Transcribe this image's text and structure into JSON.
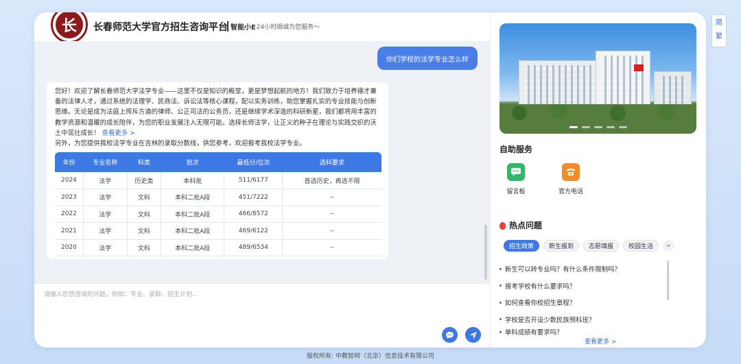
{
  "header": {
    "logo_text": "长",
    "title": "长春师范大学官方招生咨询平台",
    "brand": "智能小E",
    "slogan": "24小时竭诚为您服务～"
  },
  "chat": {
    "user_message": "你们学校的法学专业怎么样",
    "bot_reply": "您好！欢迎了解长春师范大学法学专业——这里不仅是知识的殿堂，更是梦想起航的地方！我们致力于培养德才兼备的法律人才，通过系统的法理学、民商法、诉讼法等核心课程，配以实务训练，助您掌握扎实的专业技能与创新思维。无论是成为法庭上挥斥方遒的律师、公正司法的公务员，还是继续学术深造的科研新星，我们都将用丰富的教学资源和温暖的成长陪伴，为您的职业发展注入无限可能。选择长师法学，让正义的种子在理论与实践交织的沃土中茁壮成长！",
    "read_more": "查看更多 >",
    "bot_reply_2": "另外，为您提供我校法学专业在吉林的录取分数线，供您参考，欢迎报考我校法学专业。",
    "table": {
      "headers": [
        "年份",
        "专业名称",
        "科类",
        "批次",
        "最低分/位次",
        "选科要求"
      ],
      "rows": [
        [
          "2024",
          "法学",
          "历史类",
          "本科批",
          "511/6177",
          "首选历史，再选不限"
        ],
        [
          "2023",
          "法学",
          "文科",
          "本科二批A段",
          "451/7222",
          "--"
        ],
        [
          "2022",
          "法学",
          "文科",
          "本科二批A段",
          "466/8572",
          "--"
        ],
        [
          "2021",
          "法学",
          "文科",
          "本科二批A段",
          "469/6122",
          "--"
        ],
        [
          "2020",
          "法学",
          "文科",
          "本科二批A段",
          "489/6534",
          "--"
        ]
      ]
    }
  },
  "input": {
    "placeholder": "请输入您想咨询的问题，例如：专业、录取、招生计划..."
  },
  "right": {
    "self_service_title": "自助服务",
    "services": [
      {
        "label": "留言板",
        "icon": "message-board-icon",
        "color": "#35b76a"
      },
      {
        "label": "官方电话",
        "icon": "phone-icon",
        "color": "#f08c2a"
      }
    ],
    "hot_title": "热点问题",
    "tags": [
      "招生政策",
      "新生报到",
      "志愿填报",
      "校园生活"
    ],
    "questions": [
      "新生可以转专业吗？有什么条件限制吗？",
      "报考学校有什么要求吗？",
      "如何查看你校招生章程？",
      "学校是否开设少数民族预科班？",
      "单科成绩有要求吗？"
    ],
    "more": "查看更多 >"
  },
  "side_tab": {
    "line1": "简",
    "line2": "繁"
  },
  "footer": "版权所有: 中教智网（北京）信息技术有限公司",
  "colors": {
    "accent": "#3e78e5",
    "logo": "#8b1a1a"
  }
}
